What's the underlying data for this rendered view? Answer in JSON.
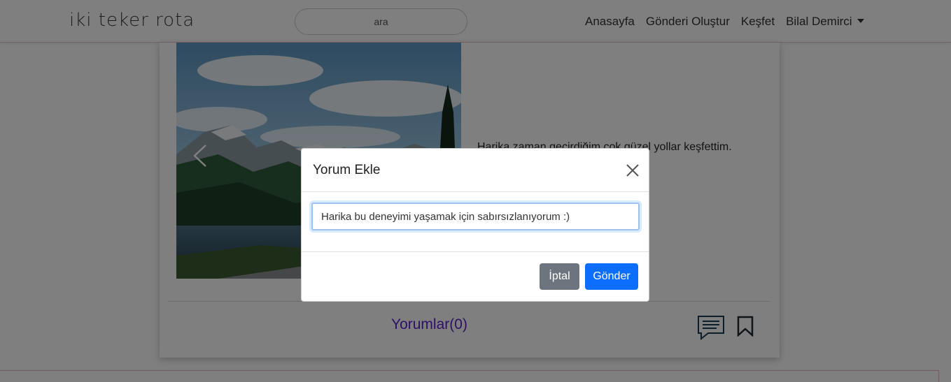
{
  "navbar": {
    "brand": "iki teker rota",
    "search_placeholder": "ara",
    "links": [
      "Anasayfa",
      "Gönderi Oluştur",
      "Keşfet"
    ],
    "user_menu": "Bilal Demirci"
  },
  "post": {
    "text": "Harika zaman geçirdiğim çok güzel yollar keşfettim. duyguları #ikiteker",
    "comments_label": "Yorumlar",
    "comments_count": "(0)"
  },
  "modal": {
    "title": "Yorum Ekle",
    "comment_value": "Harika bu deneyimi yaşamak için sabırsızlanıyorum :)",
    "cancel_label": "İptal",
    "send_label": "Gönder"
  },
  "colors": {
    "primary": "#0d6efd",
    "secondary": "#6c757d",
    "comments_link": "#5a1ed0"
  },
  "icons": [
    "chevron-left-icon",
    "close-icon",
    "comment-icon",
    "bookmark-icon"
  ]
}
